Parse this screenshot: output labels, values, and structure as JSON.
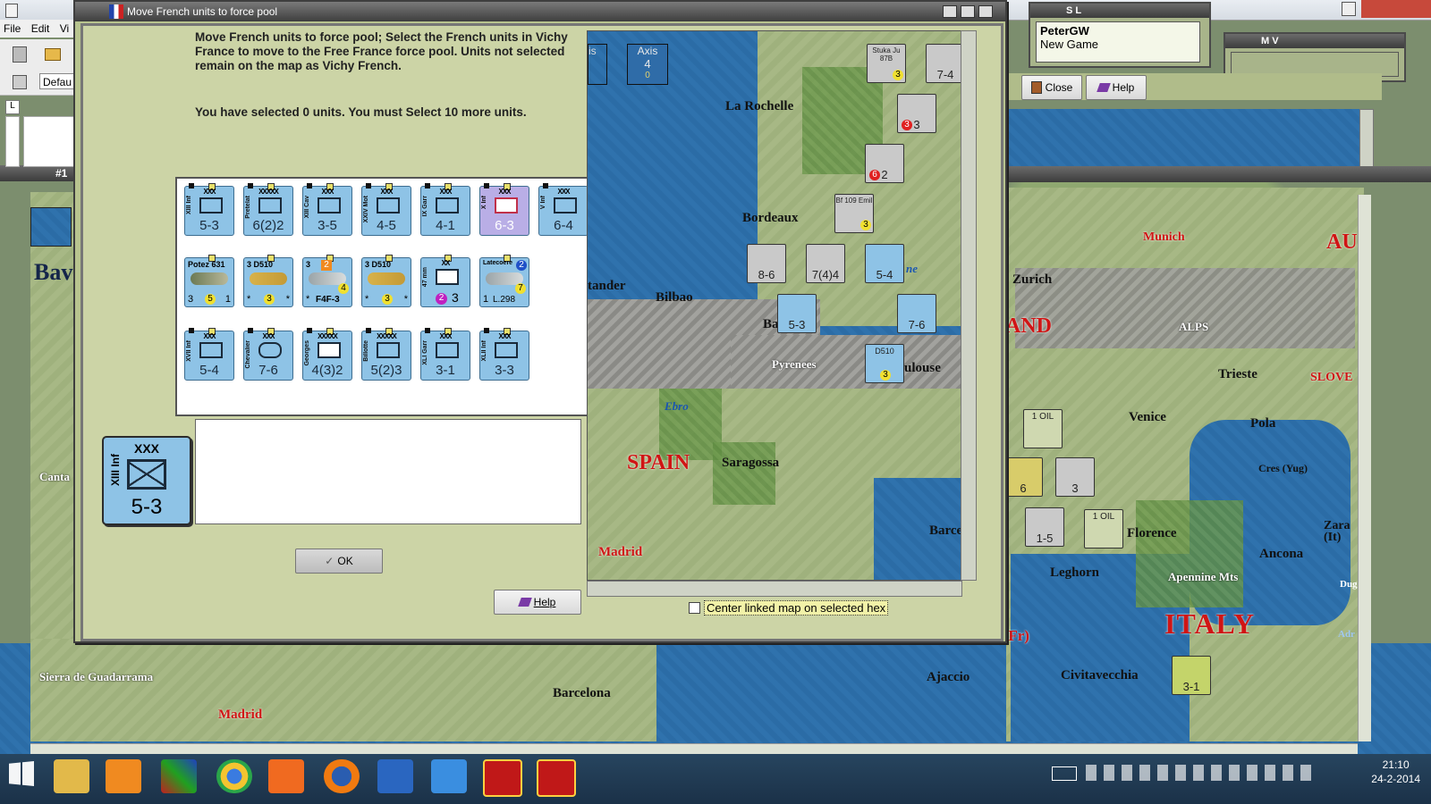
{
  "app": {
    "menu": [
      "File",
      "Edit",
      "Vi"
    ],
    "toolbar_dropdown": "Defau",
    "side_letter": "L",
    "left_tab": "#1",
    "left_labels": [
      "Bav",
      "Canta"
    ]
  },
  "background_map": {
    "labels": [
      "Munich",
      "AUS",
      "Zurich",
      "AND",
      "ALPS",
      "Trieste",
      "SLOVE",
      "Venice",
      "Pola",
      "Cres (Yug)",
      "Florence",
      "Ancona",
      "Zara (It)",
      "Leghorn",
      "Apennine Mts",
      "ITALY",
      "Civitavecchia",
      "Ajaccio",
      "CORSICA (Fr)",
      "Barcelona",
      "Madrid",
      "Sierra de Guadarrama",
      "SPAIN",
      "Dug",
      "Adr"
    ],
    "counters": [
      "1 OIL",
      "1 OIL",
      "1-5",
      "3-1",
      "6",
      "3"
    ]
  },
  "player_panel": {
    "title": "S L",
    "name": "PeterGW",
    "status": "New Game",
    "close_label": "Close",
    "help_label": "Help"
  },
  "mv_panel": {
    "title": "M V"
  },
  "dialog": {
    "title": "Move French units to force pool",
    "instructions": "Move French units to force pool; Select the French units in Vichy France to move to the Free France force pool.  Units not selected remain on the map as Vichy French.",
    "selection_status": "You have selected 0 units.  You must Select 10 more units.",
    "ok_label": "OK",
    "help_label": "Help",
    "center_checkbox_label": "Center linked map on selected hex",
    "center_checkbox_checked": false
  },
  "units_row1": [
    {
      "size": "XXX",
      "name": "XIII Inf",
      "value": "5-3"
    },
    {
      "size": "XXXXX",
      "name": "Pretelat",
      "value": "6(2)2"
    },
    {
      "size": "XXX",
      "name": "XIII Cav",
      "value": "3-5"
    },
    {
      "size": "XXX",
      "name": "XXIV Mot",
      "value": "4-5"
    },
    {
      "size": "XXX",
      "name": "IX Garr",
      "value": "4-1"
    },
    {
      "size": "XXX",
      "name": "X Inf",
      "value": "6-3",
      "selected": true
    },
    {
      "size": "XXX",
      "name": "V Inf",
      "value": "6-4"
    }
  ],
  "units_row2": [
    {
      "top": "Potez 631",
      "bl": "3",
      "mid": "5",
      "br": "1"
    },
    {
      "top": "3  D510",
      "bl": "*",
      "mid": "3",
      "br": "*"
    },
    {
      "top": "3",
      "badge": "2",
      "bl": "*",
      "mid": "F4F-3",
      "br": "4"
    },
    {
      "top": "3  D510",
      "bl": "*",
      "mid": "3",
      "br": "*"
    },
    {
      "top": "XX",
      "name": "47 mm",
      "badge": "2",
      "value": "3"
    },
    {
      "top": "Latecoere",
      "badge": "2",
      "bl": "1",
      "mid": "L.298",
      "br": "7"
    }
  ],
  "units_row3": [
    {
      "size": "XXX",
      "name": "XVII Inf",
      "value": "5-4"
    },
    {
      "size": "XXX",
      "name": "Chevalier",
      "value": "7-6"
    },
    {
      "size": "XXXXX",
      "name": "Georges",
      "value": "4(3)2"
    },
    {
      "size": "XXXXX",
      "name": "Billotte",
      "value": "5(2)3"
    },
    {
      "size": "XXX",
      "name": "XLI Garr",
      "value": "3-1"
    },
    {
      "size": "XXX",
      "name": "XLII Inf",
      "value": "3-3"
    }
  ],
  "selected_unit": {
    "size": "XXX",
    "name": "XIII Inf",
    "value": "5-3"
  },
  "dialog_map": {
    "axis_label": "Axis",
    "axis_value": "4",
    "axis_sub": "0",
    "left_edge": "is",
    "labels": [
      "La Rochelle",
      "Bordeaux",
      "tander",
      "Bilbao",
      "Pyrenees",
      "Ebro",
      "SPAIN",
      "Saragossa",
      "Madrid",
      "Barce",
      "ulouse",
      "Ba",
      "ne"
    ],
    "counters": [
      {
        "label": "Stuka Ju 87B",
        "value": "3"
      },
      {
        "label": "7-4"
      },
      {
        "label": "3",
        "value": "3"
      },
      {
        "label": "2",
        "value": "6"
      },
      {
        "label": "Bf 109 Emil",
        "value": "3"
      },
      {
        "label": "8-6"
      },
      {
        "label": "7(4)4"
      },
      {
        "label": "5-4"
      },
      {
        "label": "5-3"
      },
      {
        "label": "7-6"
      },
      {
        "label": "D510",
        "value": "3"
      }
    ]
  },
  "taskbar": {
    "time": "21:10",
    "date": "24-2-2014"
  }
}
